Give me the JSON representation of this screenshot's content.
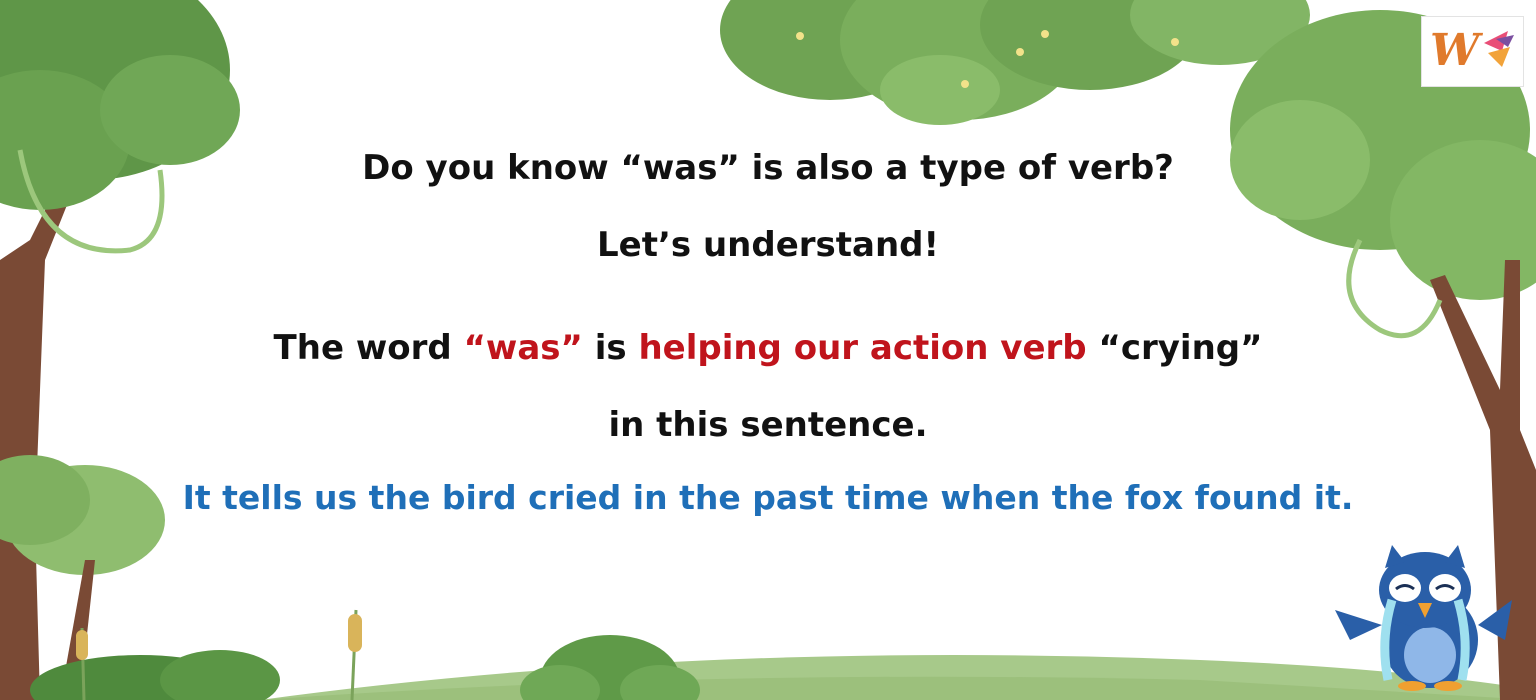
{
  "logo": {
    "letter": "W"
  },
  "content": {
    "line1": "Do you know “was” is also a type of verb?",
    "line2": "Let’s understand!",
    "line3": {
      "part1": "The word ",
      "part2": "“was”",
      "part3": " is ",
      "part4": "helping our action verb",
      "part5": " “crying”"
    },
    "line4": "in this sentence.",
    "line5": "It tells us the bird cried in the past time when the fox found it."
  },
  "colors": {
    "text": "#111111",
    "highlight_red": "#c0141c",
    "highlight_blue": "#1f6fb8",
    "tree_green": "#7fae5e",
    "trunk_brown": "#7a4a35",
    "owl_blue": "#2a5fa8"
  },
  "icons": [
    "tree-illustration",
    "bush-illustration",
    "cattail-illustration",
    "crying-owl-illustration",
    "w-logo-icon"
  ]
}
